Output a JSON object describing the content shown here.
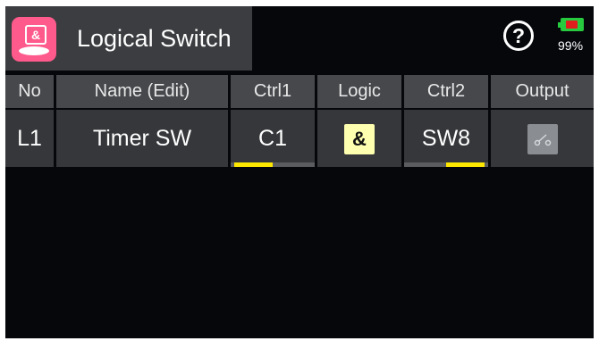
{
  "header": {
    "title": "Logical Switch",
    "app_icon": "logical-switch-icon",
    "help_icon": "help-icon",
    "battery": {
      "percent_label": "99%",
      "level": 0.99
    }
  },
  "table": {
    "columns": [
      "No",
      "Name (Edit)",
      "Ctrl1",
      "Logic",
      "Ctrl2",
      "Output"
    ],
    "rows": [
      {
        "no": "L1",
        "name": "Timer SW",
        "ctrl1": "C1",
        "ctrl1_level": 0.5,
        "logic": "&",
        "ctrl2": "SW8",
        "ctrl2_level": 0.5,
        "output_icon": "switch-off-icon"
      }
    ]
  },
  "colors": {
    "accent": "#ff5a8c",
    "indicator": "#ffe800",
    "logic_button": "#ffffb0",
    "background": "#05070b"
  }
}
